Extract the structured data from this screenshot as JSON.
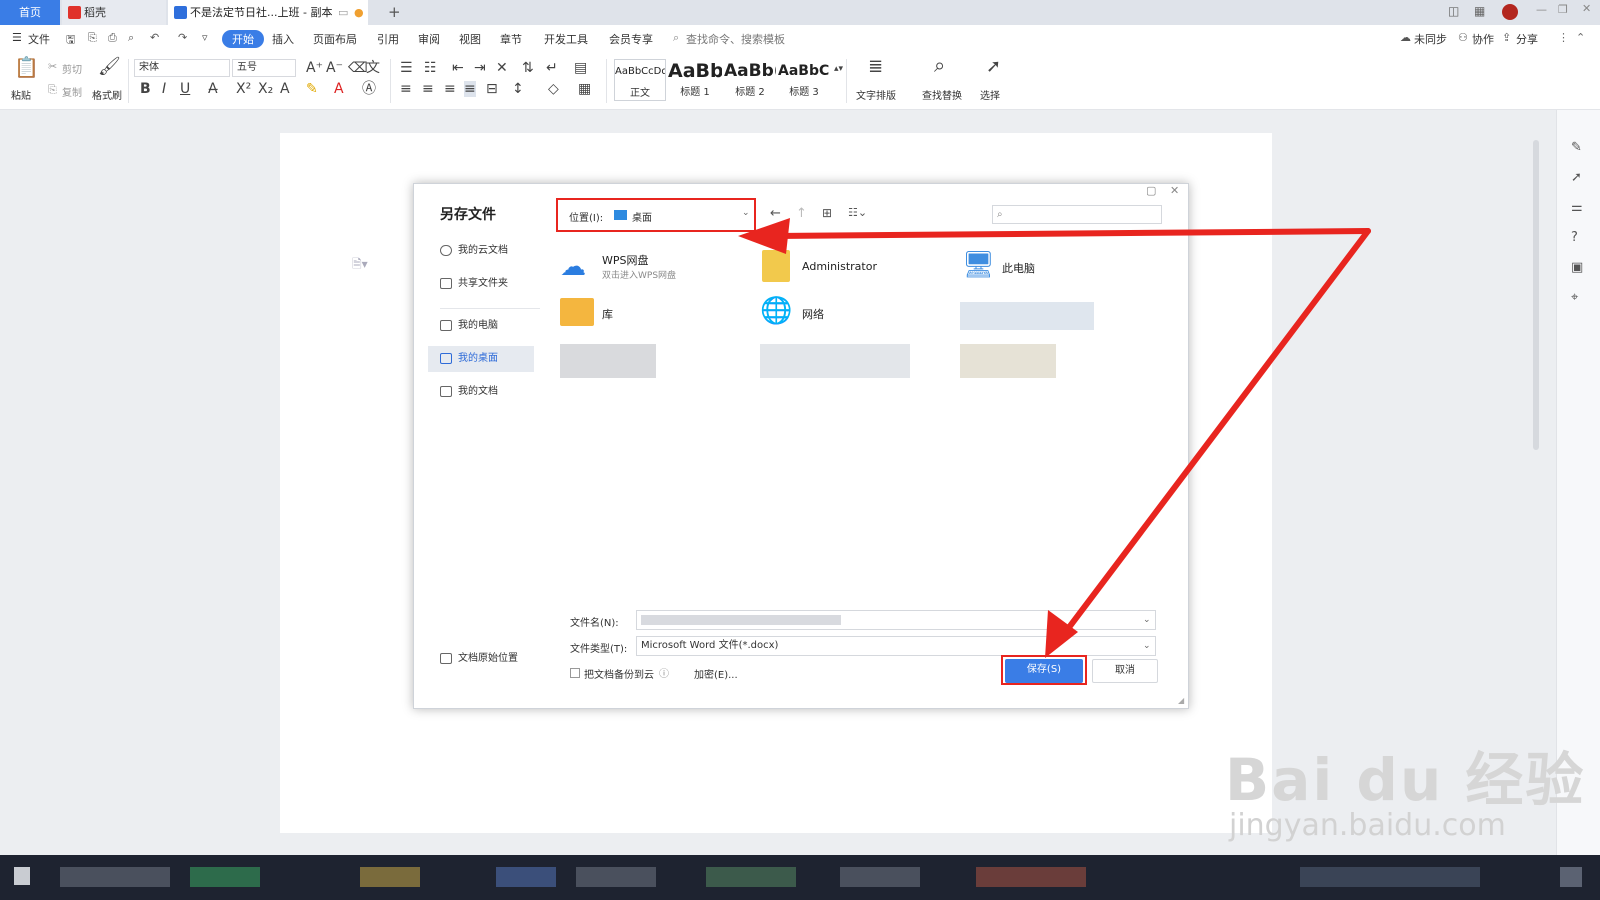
{
  "tabs": {
    "home": "首页",
    "daoke": "稻壳",
    "doc": "不是法定节日社...上班 - 副本",
    "add": "+"
  },
  "menu": {
    "file": "文件",
    "start": "开始",
    "insert": "插入",
    "layout": "页面布局",
    "reference": "引用",
    "review": "审阅",
    "view": "视图",
    "chapter": "章节",
    "dev": "开发工具",
    "member": "会员专享",
    "search": "查找命令、搜索模板",
    "unsync": "未同步",
    "collab": "协作",
    "share": "分享"
  },
  "ribbon": {
    "paste": "粘贴",
    "cut": "剪切",
    "copy": "复制",
    "format_painter": "格式刷",
    "font": "宋体",
    "size": "五号",
    "styles": [
      {
        "preview": "AaBbCcDd",
        "label": "正文"
      },
      {
        "preview": "AaBb",
        "label": "标题 1"
      },
      {
        "preview": "AaBb(",
        "label": "标题 2"
      },
      {
        "preview": "AaBbC(",
        "label": "标题 3"
      }
    ],
    "text_layout": "文字排版",
    "find_replace": "查找替换",
    "select": "选择"
  },
  "dialog": {
    "title": "另存文件",
    "sidebar": [
      "我的云文档",
      "共享文件夹",
      "我的电脑",
      "我的桌面",
      "我的文档"
    ],
    "original_location": "文档原始位置",
    "location_label": "位置(I):",
    "location_value": "桌面",
    "files": {
      "wps_cloud": "WPS网盘",
      "wps_cloud_sub": "双击进入WPS网盘",
      "admin": "Administrator",
      "this_pc": "此电脑",
      "library": "库",
      "network": "网络"
    },
    "filename_label": "文件名(N):",
    "filetype_label": "文件类型(T):",
    "filetype_value": "Microsoft Word 文件(*.docx)",
    "backup": "把文档备份到云",
    "encrypt": "加密(E)...",
    "save": "保存(S)",
    "cancel": "取消"
  },
  "watermark": {
    "brand": "Bai du 经验",
    "url": "jingyan.baidu.com"
  },
  "colors": {
    "accent": "#3a7de6",
    "annotation": "#e8251f"
  }
}
